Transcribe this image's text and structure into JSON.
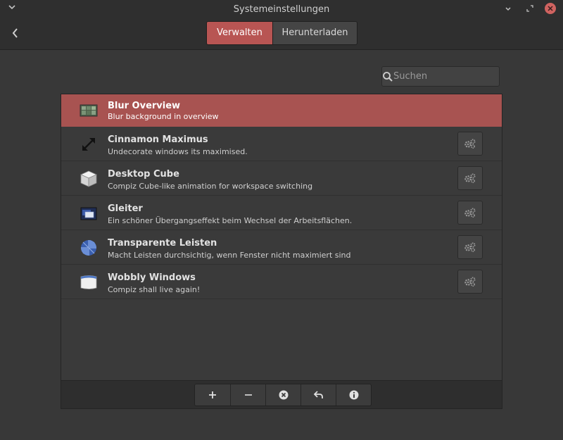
{
  "window": {
    "title": "Systemeinstellungen"
  },
  "tabs": [
    {
      "label": "Verwalten",
      "active": true
    },
    {
      "label": "Herunterladen",
      "active": false
    }
  ],
  "search": {
    "placeholder": "Suchen",
    "value": ""
  },
  "extensions": [
    {
      "title": "Blur Overview",
      "description": "Blur background in overview",
      "icon": "blur-overview-icon",
      "selected": true,
      "has_config": false
    },
    {
      "title": "Cinnamon Maximus",
      "description": "Undecorate windows its maximised.",
      "icon": "maximize-arrows-icon",
      "selected": false,
      "has_config": true
    },
    {
      "title": "Desktop Cube",
      "description": "Compiz Cube-like animation for workspace switching",
      "icon": "cube-icon",
      "selected": false,
      "has_config": true
    },
    {
      "title": "Gleiter",
      "description": "Ein schöner Übergangseffekt beim Wechsel der Arbeitsflächen.",
      "icon": "gleiter-icon",
      "selected": false,
      "has_config": true
    },
    {
      "title": "Transparente Leisten",
      "description": "Macht Leisten durchsichtig, wenn Fenster nicht maximiert sind",
      "icon": "transparent-panels-icon",
      "selected": false,
      "has_config": true
    },
    {
      "title": "Wobbly Windows",
      "description": "Compiz shall live again!",
      "icon": "wobbly-window-icon",
      "selected": false,
      "has_config": true
    }
  ],
  "toolbar": {
    "buttons": [
      {
        "name": "add",
        "icon": "plus-icon"
      },
      {
        "name": "remove",
        "icon": "minus-icon"
      },
      {
        "name": "disable",
        "icon": "close-circle-icon"
      },
      {
        "name": "undo",
        "icon": "undo-icon"
      },
      {
        "name": "info",
        "icon": "info-icon"
      }
    ]
  },
  "colors": {
    "accent": "#b85553",
    "selected_row": "#a85351",
    "close_button": "#d06360",
    "background": "#383838"
  }
}
